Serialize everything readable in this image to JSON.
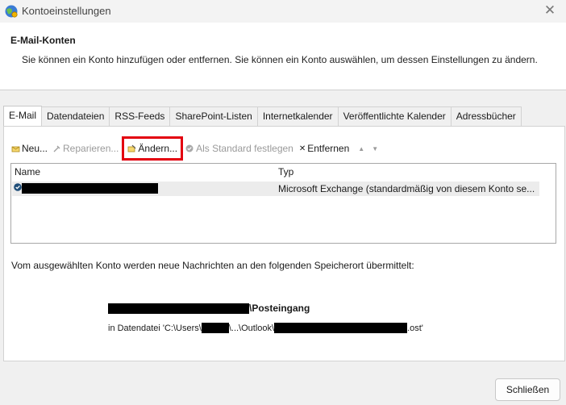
{
  "window": {
    "title": "Kontoeinstellungen",
    "close_glyph": "✕"
  },
  "header": {
    "heading": "E-Mail-Konten",
    "description": "Sie können ein Konto hinzufügen oder entfernen. Sie können ein Konto auswählen, um dessen Einstellungen zu ändern."
  },
  "tabs": [
    {
      "label": "E-Mail",
      "active": true
    },
    {
      "label": "Datendateien"
    },
    {
      "label": "RSS-Feeds"
    },
    {
      "label": "SharePoint-Listen"
    },
    {
      "label": "Internetkalender"
    },
    {
      "label": "Veröffentlichte Kalender"
    },
    {
      "label": "Adressbücher"
    }
  ],
  "toolbar": {
    "new_label": "Neu...",
    "repair_label": "Reparieren...",
    "change_label": "Ändern...",
    "default_label": "Als Standard festlegen",
    "remove_label": "Entfernen",
    "remove_icon_glyph": "✕",
    "up_glyph": "▲",
    "down_glyph": "▼"
  },
  "account_list": {
    "columns": [
      "Name",
      "Typ"
    ],
    "rows": [
      {
        "name": "",
        "type": "Microsoft Exchange (standardmäßig von diesem Konto se..."
      }
    ]
  },
  "info_text": "Vom ausgewählten Konto werden neue Nachrichten an den folgenden Speicherort übermittelt:",
  "delivery": {
    "folder_suffix": "\\Posteingang",
    "file_prefix": "in Datendatei 'C:\\Users\\",
    "file_middle": "\\...\\Outlook\\",
    "file_suffix": ".ost'"
  },
  "footer": {
    "close_button": "Schließen"
  },
  "colors": {
    "highlight_box": "#e3000f",
    "selected_row": "#ececec",
    "check_icon": "#1f4e79"
  }
}
